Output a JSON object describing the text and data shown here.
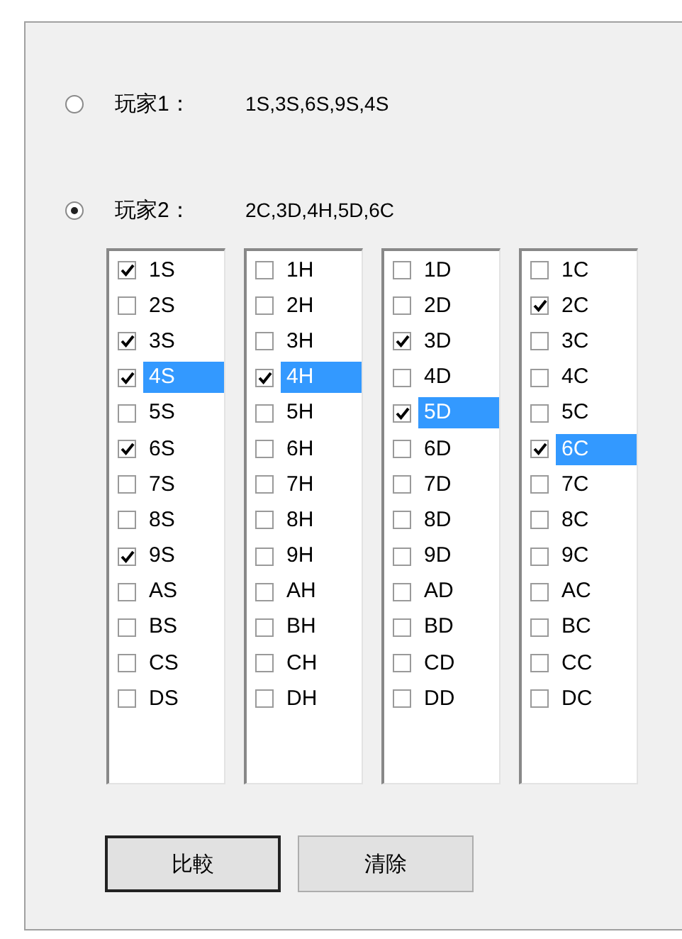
{
  "players": [
    {
      "label": "玩家1：",
      "hand": "1S,3S,6S,9S,4S",
      "selected": false
    },
    {
      "label": "玩家2：",
      "hand": "2C,3D,4H,5D,6C",
      "selected": true
    }
  ],
  "card_lists": [
    {
      "items": [
        {
          "label": "1S",
          "checked": true,
          "selected": false
        },
        {
          "label": "2S",
          "checked": false,
          "selected": false
        },
        {
          "label": "3S",
          "checked": true,
          "selected": false
        },
        {
          "label": "4S",
          "checked": true,
          "selected": true
        },
        {
          "label": "5S",
          "checked": false,
          "selected": false
        },
        {
          "label": "6S",
          "checked": true,
          "selected": false
        },
        {
          "label": "7S",
          "checked": false,
          "selected": false
        },
        {
          "label": "8S",
          "checked": false,
          "selected": false
        },
        {
          "label": "9S",
          "checked": true,
          "selected": false
        },
        {
          "label": "AS",
          "checked": false,
          "selected": false
        },
        {
          "label": "BS",
          "checked": false,
          "selected": false
        },
        {
          "label": "CS",
          "checked": false,
          "selected": false
        },
        {
          "label": "DS",
          "checked": false,
          "selected": false
        }
      ]
    },
    {
      "items": [
        {
          "label": "1H",
          "checked": false,
          "selected": false
        },
        {
          "label": "2H",
          "checked": false,
          "selected": false
        },
        {
          "label": "3H",
          "checked": false,
          "selected": false
        },
        {
          "label": "4H",
          "checked": true,
          "selected": true
        },
        {
          "label": "5H",
          "checked": false,
          "selected": false
        },
        {
          "label": "6H",
          "checked": false,
          "selected": false
        },
        {
          "label": "7H",
          "checked": false,
          "selected": false
        },
        {
          "label": "8H",
          "checked": false,
          "selected": false
        },
        {
          "label": "9H",
          "checked": false,
          "selected": false
        },
        {
          "label": "AH",
          "checked": false,
          "selected": false
        },
        {
          "label": "BH",
          "checked": false,
          "selected": false
        },
        {
          "label": "CH",
          "checked": false,
          "selected": false
        },
        {
          "label": "DH",
          "checked": false,
          "selected": false
        }
      ]
    },
    {
      "items": [
        {
          "label": "1D",
          "checked": false,
          "selected": false
        },
        {
          "label": "2D",
          "checked": false,
          "selected": false
        },
        {
          "label": "3D",
          "checked": true,
          "selected": false
        },
        {
          "label": "4D",
          "checked": false,
          "selected": false
        },
        {
          "label": "5D",
          "checked": true,
          "selected": true
        },
        {
          "label": "6D",
          "checked": false,
          "selected": false
        },
        {
          "label": "7D",
          "checked": false,
          "selected": false
        },
        {
          "label": "8D",
          "checked": false,
          "selected": false
        },
        {
          "label": "9D",
          "checked": false,
          "selected": false
        },
        {
          "label": "AD",
          "checked": false,
          "selected": false
        },
        {
          "label": "BD",
          "checked": false,
          "selected": false
        },
        {
          "label": "CD",
          "checked": false,
          "selected": false
        },
        {
          "label": "DD",
          "checked": false,
          "selected": false
        }
      ]
    },
    {
      "items": [
        {
          "label": "1C",
          "checked": false,
          "selected": false
        },
        {
          "label": "2C",
          "checked": true,
          "selected": false
        },
        {
          "label": "3C",
          "checked": false,
          "selected": false
        },
        {
          "label": "4C",
          "checked": false,
          "selected": false
        },
        {
          "label": "5C",
          "checked": false,
          "selected": false
        },
        {
          "label": "6C",
          "checked": true,
          "selected": true
        },
        {
          "label": "7C",
          "checked": false,
          "selected": false
        },
        {
          "label": "8C",
          "checked": false,
          "selected": false
        },
        {
          "label": "9C",
          "checked": false,
          "selected": false
        },
        {
          "label": "AC",
          "checked": false,
          "selected": false
        },
        {
          "label": "BC",
          "checked": false,
          "selected": false
        },
        {
          "label": "CC",
          "checked": false,
          "selected": false
        },
        {
          "label": "DC",
          "checked": false,
          "selected": false
        }
      ]
    }
  ],
  "buttons": [
    {
      "label": "比較",
      "default": true
    },
    {
      "label": "清除",
      "default": false
    }
  ]
}
